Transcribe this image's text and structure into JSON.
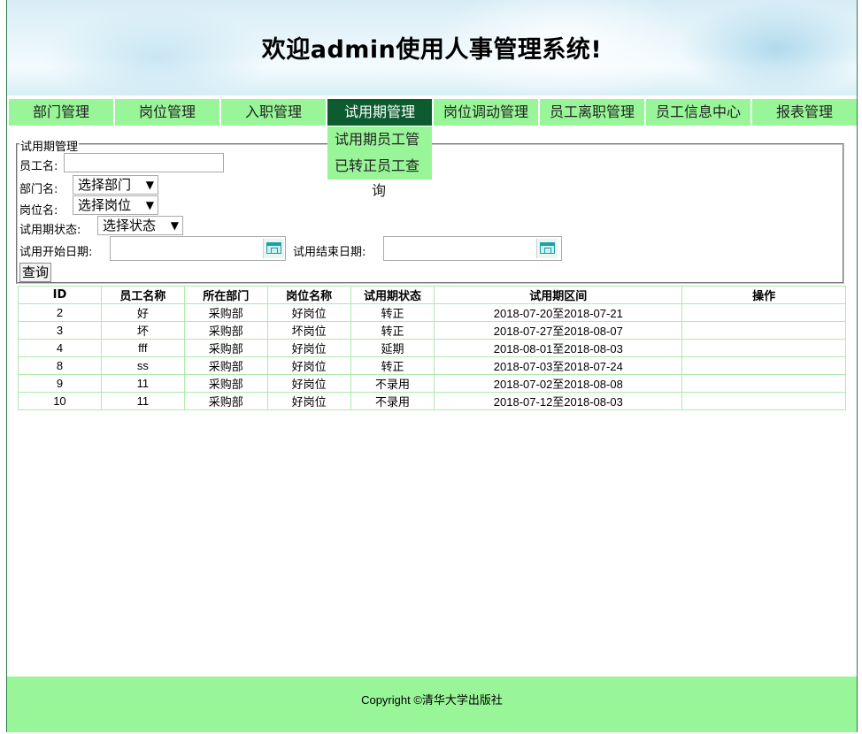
{
  "header": {
    "title": "欢迎admin使用人事管理系统!"
  },
  "nav": {
    "items": [
      {
        "label": "部门管理"
      },
      {
        "label": "岗位管理"
      },
      {
        "label": "入职管理"
      },
      {
        "label": "试用期管理"
      },
      {
        "label": "岗位调动管理"
      },
      {
        "label": "员工离职管理"
      },
      {
        "label": "员工信息中心"
      },
      {
        "label": "报表管理"
      }
    ],
    "active_index": 3,
    "dropdown": {
      "items": [
        {
          "label": "试用期员工管"
        },
        {
          "label": "已转正员工查"
        }
      ],
      "overflow_text": "询"
    }
  },
  "search": {
    "legend": "试用期管理",
    "employee_label": "员工名:",
    "employee_value": "",
    "dept_label": "部门名:",
    "dept_selected": "选择部门",
    "post_label": "岗位名:",
    "post_selected": "选择岗位",
    "status_label": "试用期状态:",
    "status_selected": "选择状态",
    "start_label": "试用开始日期:",
    "start_value": "",
    "end_label": "试用结束日期:",
    "end_value": "",
    "button_label": "查询"
  },
  "table": {
    "headers": [
      "ID",
      "员工名称",
      "所在部门",
      "岗位名称",
      "试用期状态",
      "试用期区间",
      "操作"
    ],
    "rows": [
      [
        "2",
        "好",
        "采购部",
        "好岗位",
        "转正",
        "2018-07-20至2018-07-21",
        ""
      ],
      [
        "3",
        "坏",
        "采购部",
        "坏岗位",
        "转正",
        "2018-07-27至2018-08-07",
        ""
      ],
      [
        "4",
        "fff",
        "采购部",
        "好岗位",
        "延期",
        "2018-08-01至2018-08-03",
        ""
      ],
      [
        "8",
        "ss",
        "采购部",
        "好岗位",
        "转正",
        "2018-07-03至2018-07-24",
        ""
      ],
      [
        "9",
        "11",
        "采购部",
        "好岗位",
        "不录用",
        "2018-07-02至2018-08-08",
        ""
      ],
      [
        "10",
        "11",
        "采购部",
        "好岗位",
        "不录用",
        "2018-07-12至2018-08-03",
        ""
      ]
    ]
  },
  "footer": {
    "copyright": "Copyright ©清华大学出版社"
  },
  "colors": {
    "nav_bg": "#98f598",
    "nav_active_bg": "#0d5c30",
    "table_border": "#aeeaae",
    "footer_bg": "#98f598"
  }
}
